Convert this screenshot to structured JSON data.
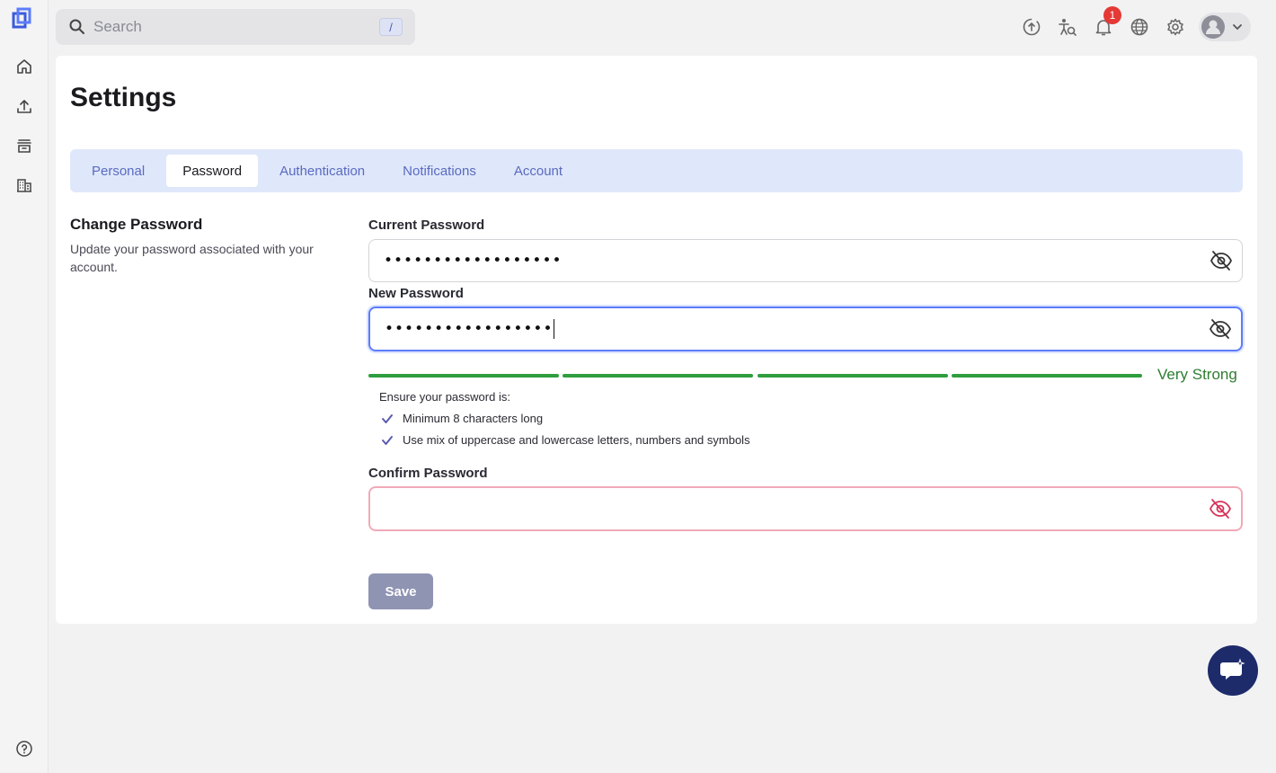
{
  "search": {
    "placeholder": "Search",
    "shortcut": "/"
  },
  "notifications": {
    "count": "1"
  },
  "page": {
    "title": "Settings"
  },
  "tabs": [
    {
      "label": "Personal"
    },
    {
      "label": "Password"
    },
    {
      "label": "Authentication"
    },
    {
      "label": "Notifications"
    },
    {
      "label": "Account"
    }
  ],
  "active_tab": "Password",
  "section": {
    "title": "Change Password",
    "description": "Update your password associated with your account."
  },
  "current_password": {
    "label": "Current Password",
    "masked_value": "••••••••••••••••••"
  },
  "new_password": {
    "label": "New Password",
    "masked_value": "•••••••••••••••••"
  },
  "strength": {
    "label": "Very Strong",
    "filled_segments": 4,
    "total_segments": 4,
    "color": "#2e9e3e"
  },
  "requirements": {
    "title": "Ensure your password is:",
    "items": [
      {
        "text": "Minimum 8 characters long",
        "met": true
      },
      {
        "text": "Use mix of uppercase and lowercase letters, numbers and symbols",
        "met": true
      }
    ]
  },
  "confirm_password": {
    "label": "Confirm Password",
    "value": ""
  },
  "save": {
    "label": "Save"
  },
  "colors": {
    "accent": "#5a6ac0",
    "error_border": "#f1aab8",
    "success": "#2e9e3e",
    "fab": "#1d2b6b"
  }
}
